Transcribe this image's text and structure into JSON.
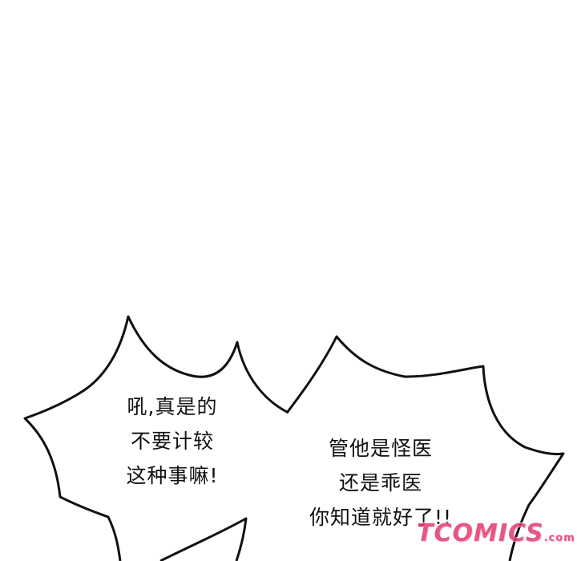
{
  "bubble_left": {
    "lines": [
      "吼,真是的",
      "不要计较",
      "这种事嘛!"
    ]
  },
  "bubble_right": {
    "lines": [
      "管他是怪医",
      "还是乖医",
      "你知道就好了!!"
    ]
  },
  "watermark": {
    "text": "TCOMICS",
    "suffix": ".com",
    "color": "#e23a6e"
  }
}
